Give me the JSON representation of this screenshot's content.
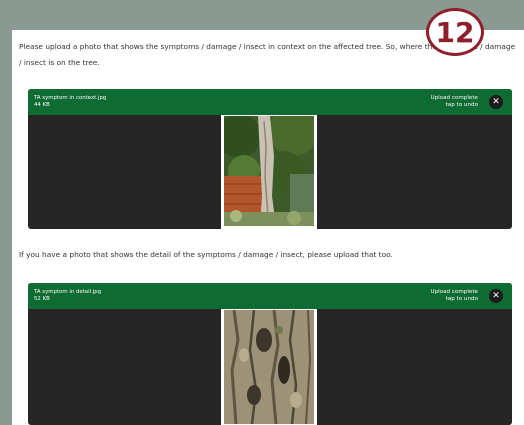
{
  "step_badge": "12",
  "instructions": {
    "context": "Please upload a photo that shows the symptoms / damage / insect in context on the affected tree. So, where the symptoms / damage / insect is on the tree.",
    "detail": "If you have a photo that shows the detail of the symptoms / damage / insect, please upload that too."
  },
  "uploads": [
    {
      "filename": "TA symptom in context.jpg",
      "size": "44 KB",
      "status": "Upload complete",
      "undo_hint": "tap to undo",
      "close_icon": "close-icon"
    },
    {
      "filename": "TA symptom in detail.jpg",
      "size": "52 KB",
      "status": "Upload complete",
      "undo_hint": "tap to undo",
      "close_icon": "close-icon"
    }
  ],
  "colors": {
    "backdrop": "#8a9a93",
    "upload_bar": "#0e6b32",
    "upload_body": "#262626",
    "badge": "#8e1f2b"
  }
}
